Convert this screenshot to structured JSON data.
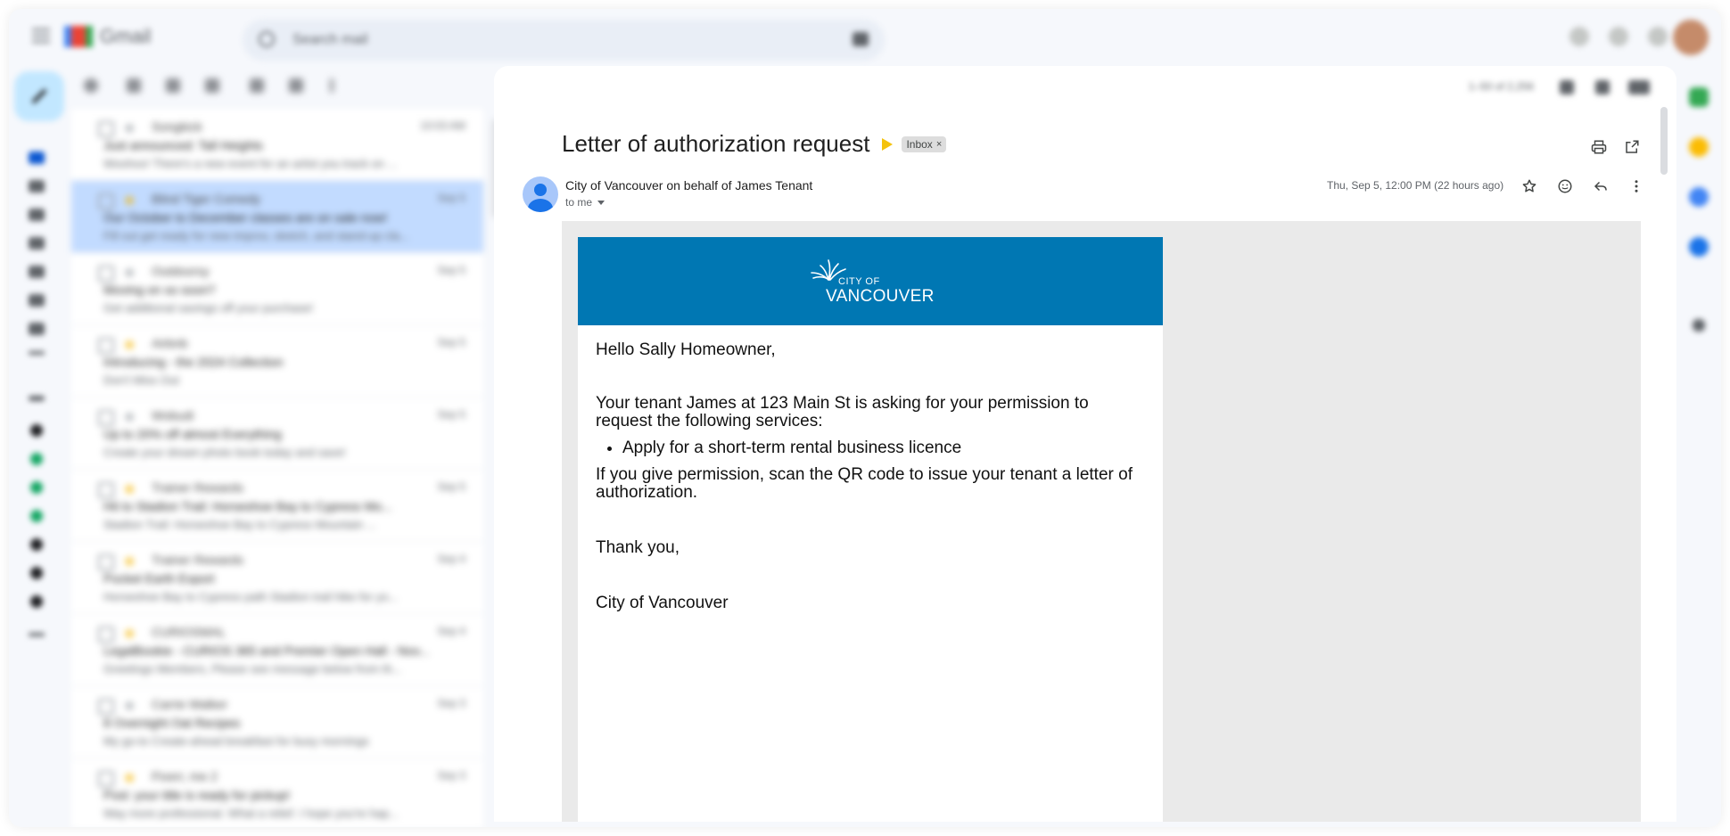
{
  "app": {
    "name": "Gmail",
    "search_placeholder": "Search mail",
    "pager": "1–50 of 2,256"
  },
  "colors": {
    "accent": "#0b57d0",
    "compose_bg": "#c2e7ff",
    "selected_row": "#c2dbff",
    "banner_blue": "#0077b3",
    "important_marker": "#f4c20d"
  },
  "message_list": [
    {
      "sender": "Songkick",
      "date": "10:03 AM",
      "subject": "Just announced: Tall Heights",
      "snippet": "Woohoo! There's a new event for an artist you track on ...",
      "starred": false,
      "selected": false
    },
    {
      "sender": "Blind Tiger Comedy",
      "date": "Sep 5",
      "subject": "Our October to December classes are on sale now!",
      "snippet": "Fill out get ready for new improv, sketch, and stand-up cla...",
      "starred": true,
      "selected": true
    },
    {
      "sender": "Outdoorsy",
      "date": "Sep 5",
      "subject": "Moving on so soon?",
      "snippet": "Get additional savings off your purchase!",
      "starred": false,
      "selected": false
    },
    {
      "sender": "Airbnb",
      "date": "Sep 5",
      "subject": "Introducing - the 2024 Collection",
      "snippet": "Don't Miss Out",
      "starred": true,
      "selected": false
    },
    {
      "sender": "Wobudi",
      "date": "Sep 5",
      "subject": "Up to 20% off almost Everything",
      "snippet": "Create your dream photo book today and save!",
      "starred": false,
      "selected": false
    },
    {
      "sender": "Trainer Rewards",
      "date": "Sep 5",
      "subject": "Hit to Stadion Trail: Horseshoe Bay to Cypress Mo...",
      "snippet": "Stadion Trail: Horseshoe Bay to Cypress Mountain ...",
      "starred": true,
      "selected": false
    },
    {
      "sender": "Trainer Rewards",
      "date": "Sep 4",
      "subject": "Pocket Earth Export",
      "snippet": "Horseshoe Bay to Cypress path Stadion trail hike for yo...",
      "starred": true,
      "selected": false
    },
    {
      "sender": "CURIOSMAL",
      "date": "Sep 4",
      "subject": "LegalBookie - CURIOS 365 and Premier Open Hall - Nov...",
      "snippet": "Greetings Members, Please see message below from th...",
      "starred": true,
      "selected": false
    },
    {
      "sender": "Carrie Walker",
      "date": "Sep 3",
      "subject": "8 Overnight Oat Recipes",
      "snippet": "My go-to Create-ahead breakfast for busy mornings",
      "starred": false,
      "selected": false
    },
    {
      "sender": "Fiverr, me 2",
      "date": "Sep 3",
      "subject": "Psst: your title is ready for pickup!",
      "snippet": "Way more professional. What a relief. I hope you're hap...",
      "starred": true,
      "selected": false
    }
  ],
  "email": {
    "subject": "Letter of authorization request",
    "label": "Inbox",
    "label_remove": "×",
    "sender": "City of Vancouver on behalf of James Tenant",
    "recipient": "to me",
    "datetime": "Thu, Sep 5, 12:00 PM (22 hours ago)",
    "logo_top": "CITY OF",
    "logo_bottom": "VANCOUVER",
    "greeting": "Hello Sally Homeowner,",
    "para1": "Your tenant James at 123 Main St is asking for your permission to request the following services:",
    "services": [
      "Apply for a short-term rental business licence"
    ],
    "para2": "If you give permission, scan the QR code to issue your tenant a letter of authorization.",
    "closing": "Thank you,",
    "signature": "City of Vancouver"
  },
  "icons": {
    "toolbar": [
      "select-all-checkbox-icon",
      "archive-icon",
      "report-spam-icon",
      "delete-icon",
      "mark-unread-icon",
      "snooze-icon",
      "more-icon"
    ],
    "message_actions": [
      "star-icon",
      "emoji-icon",
      "reply-icon",
      "more-vert-icon"
    ]
  }
}
